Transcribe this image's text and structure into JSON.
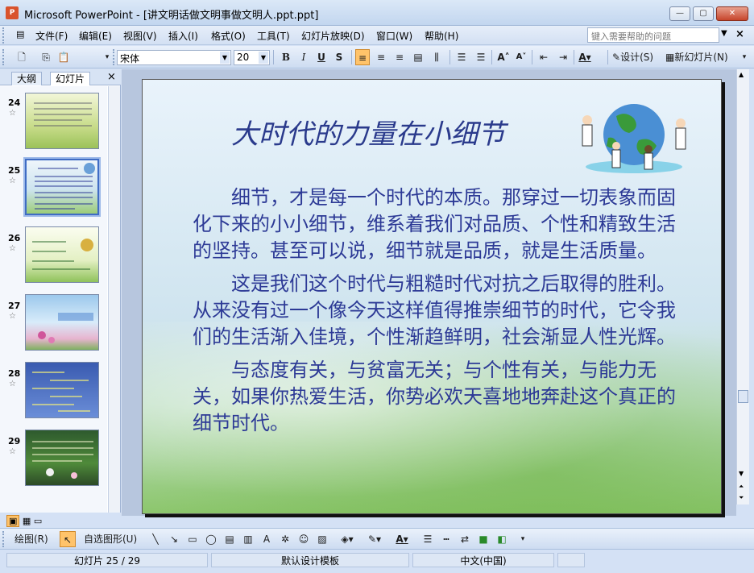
{
  "window": {
    "app_icon": "P",
    "title": "Microsoft PowerPoint - [讲文明话做文明事做文明人.ppt.ppt]",
    "min_glyph": "—",
    "max_glyph": "▢",
    "close_glyph": "✕"
  },
  "menu": {
    "items": [
      "文件(F)",
      "编辑(E)",
      "视图(V)",
      "插入(I)",
      "格式(O)",
      "工具(T)",
      "幻灯片放映(D)",
      "窗口(W)",
      "帮助(H)"
    ],
    "help_placeholder": "键入需要帮助的问题",
    "help_arrow": "▼",
    "close_glyph": "×"
  },
  "toolbar": {
    "font_name": "宋体",
    "font_size": "20",
    "bold": "B",
    "italic": "I",
    "underline": "U",
    "shadow": "S",
    "design_label": "设计(S)",
    "new_slide_label": "新幻灯片(N)"
  },
  "left_pane": {
    "tabs": [
      "大纲",
      "幻灯片"
    ],
    "close_glyph": "×",
    "slides": [
      {
        "num": "24"
      },
      {
        "num": "25"
      },
      {
        "num": "26"
      },
      {
        "num": "27"
      },
      {
        "num": "28"
      },
      {
        "num": "29"
      }
    ],
    "star": "☆"
  },
  "slide": {
    "title": "大时代的力量在小细节",
    "paragraphs": [
      "细节，才是每一个时代的本质。那穿过一切表象而固化下来的小小细节，维系着我们对品质、个性和精致生活的坚持。甚至可以说，细节就是品质，就是生活质量。",
      "这是我们这个时代与粗糙时代对抗之后取得的胜利。从来没有过一个像今天这样值得推崇细节的时代，它令我们的生活渐入佳境，个性渐趋鲜明，社会渐显人性光辉。",
      "与态度有关，与贫富无关；与个性有关，与能力无关，如果你热爱生活，你势必欢天喜地地奔赴这个真正的细节时代。"
    ]
  },
  "drawbar": {
    "draw_label": "绘图(R)",
    "autoshape_label": "自选图形(U)"
  },
  "status": {
    "slide_pos": "幻灯片 25 / 29",
    "template": "默认设计模板",
    "language": "中文(中国)"
  },
  "colors": {
    "title_blue": "#2a3a8c",
    "body_blue": "#2d3a96",
    "accent_orange": "#ffc36a"
  }
}
